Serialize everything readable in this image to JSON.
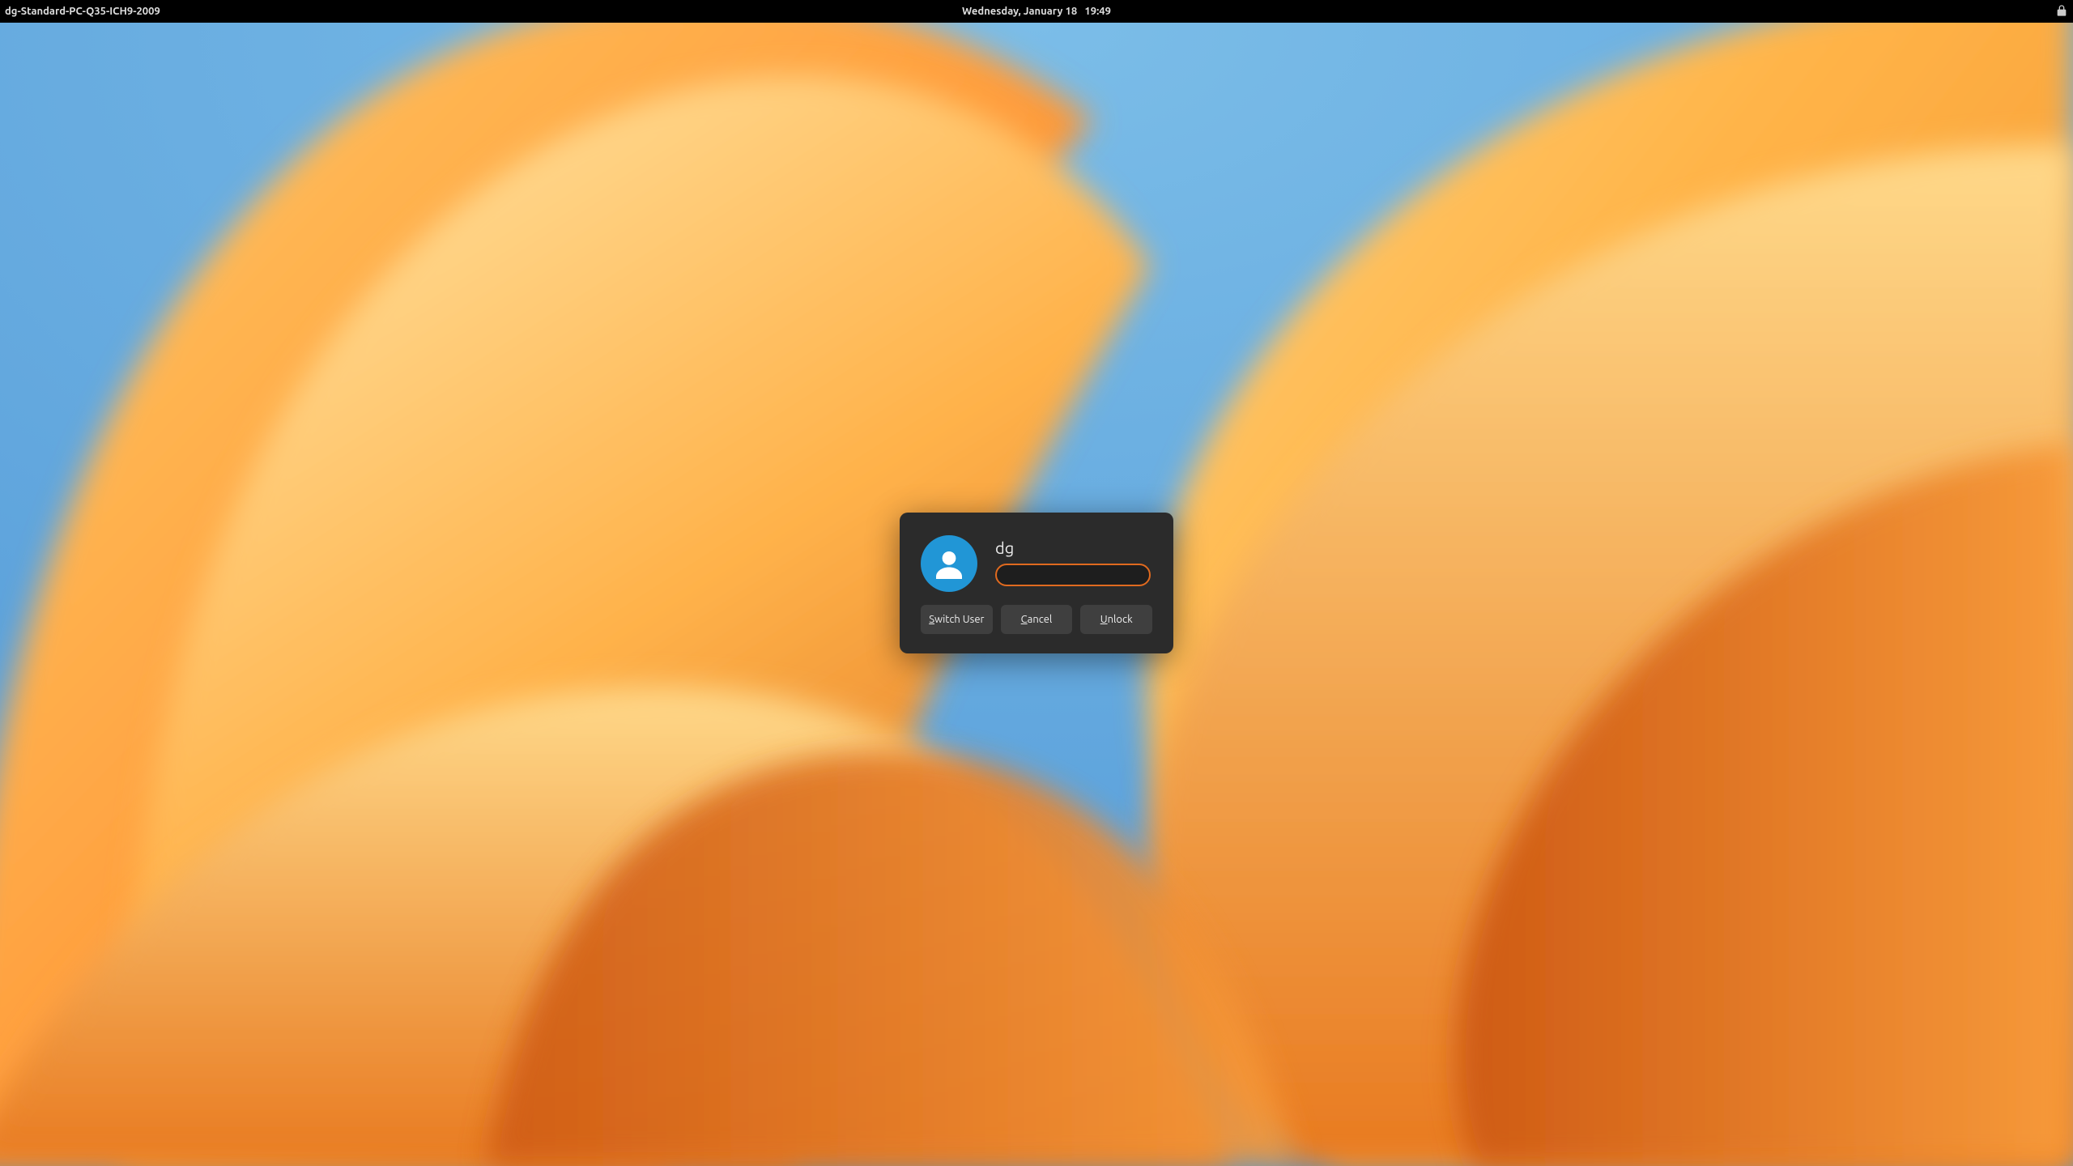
{
  "panel": {
    "hostname": "dg-Standard-PC-Q35-ICH9-2009",
    "date": "Wednesday, January 18",
    "time": "19:49"
  },
  "dialog": {
    "username": "dg",
    "password_value": "",
    "password_placeholder": "",
    "buttons": {
      "switch_user": "Switch User",
      "cancel": "Cancel",
      "unlock": "Unlock"
    },
    "accent_color": "#e06a1f"
  },
  "icons": {
    "lock": "lock-icon",
    "user": "user-icon"
  }
}
